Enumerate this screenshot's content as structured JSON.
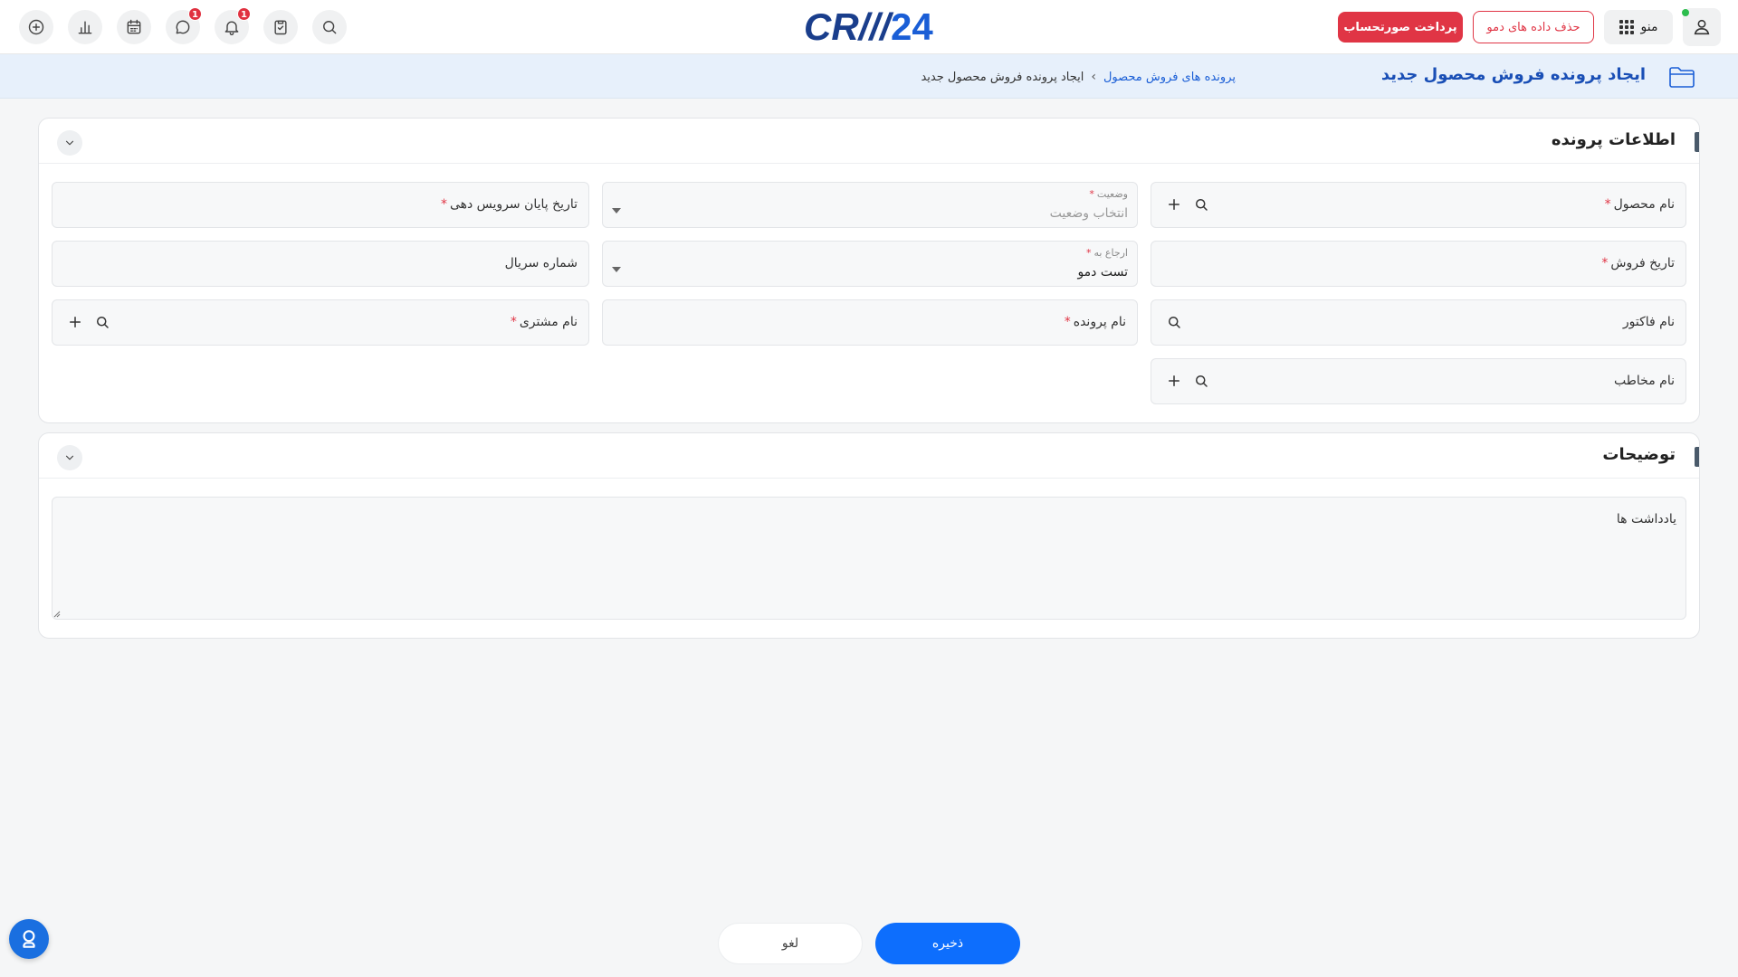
{
  "topbar": {
    "pay_invoice_label": "پرداخت صورتحساب",
    "delete_demo_label": "حذف داده های دمو",
    "menu_label": "منو",
    "chat_badge": "1",
    "notification_badge": "1",
    "logo_text_crm": "CR///",
    "logo_text_num": "24",
    "brand_color": "#1a5ed6"
  },
  "header": {
    "title": "ایجاد پرونده فروش محصول جدید",
    "breadcrumb_parent": "پرونده های فروش محصول",
    "breadcrumb_separator": "›",
    "breadcrumb_current": "ایجاد پرونده فروش محصول جدید"
  },
  "info_section": {
    "title": "اطلاعات پرونده",
    "fields": {
      "product_name": "نام محصول",
      "status_label": "وضعیت",
      "status_placeholder": "انتخاب وضعیت",
      "service_end_date": "تاریخ پایان سرویس دهی",
      "sale_date": "تاریخ فروش",
      "assigned_label": "ارجاع به",
      "assigned_value": "تست دمو",
      "serial_number": "شماره سریال",
      "invoice_name": "نام فاکتور",
      "case_name": "نام پرونده",
      "customer_name": "نام مشتری",
      "contact_name": "نام مخاطب",
      "required_mark": "*"
    }
  },
  "description_section": {
    "title": "توضیحات",
    "notes_label": "یادداشت ها"
  },
  "actions": {
    "save_label": "ذخیره",
    "cancel_label": "لغو"
  }
}
